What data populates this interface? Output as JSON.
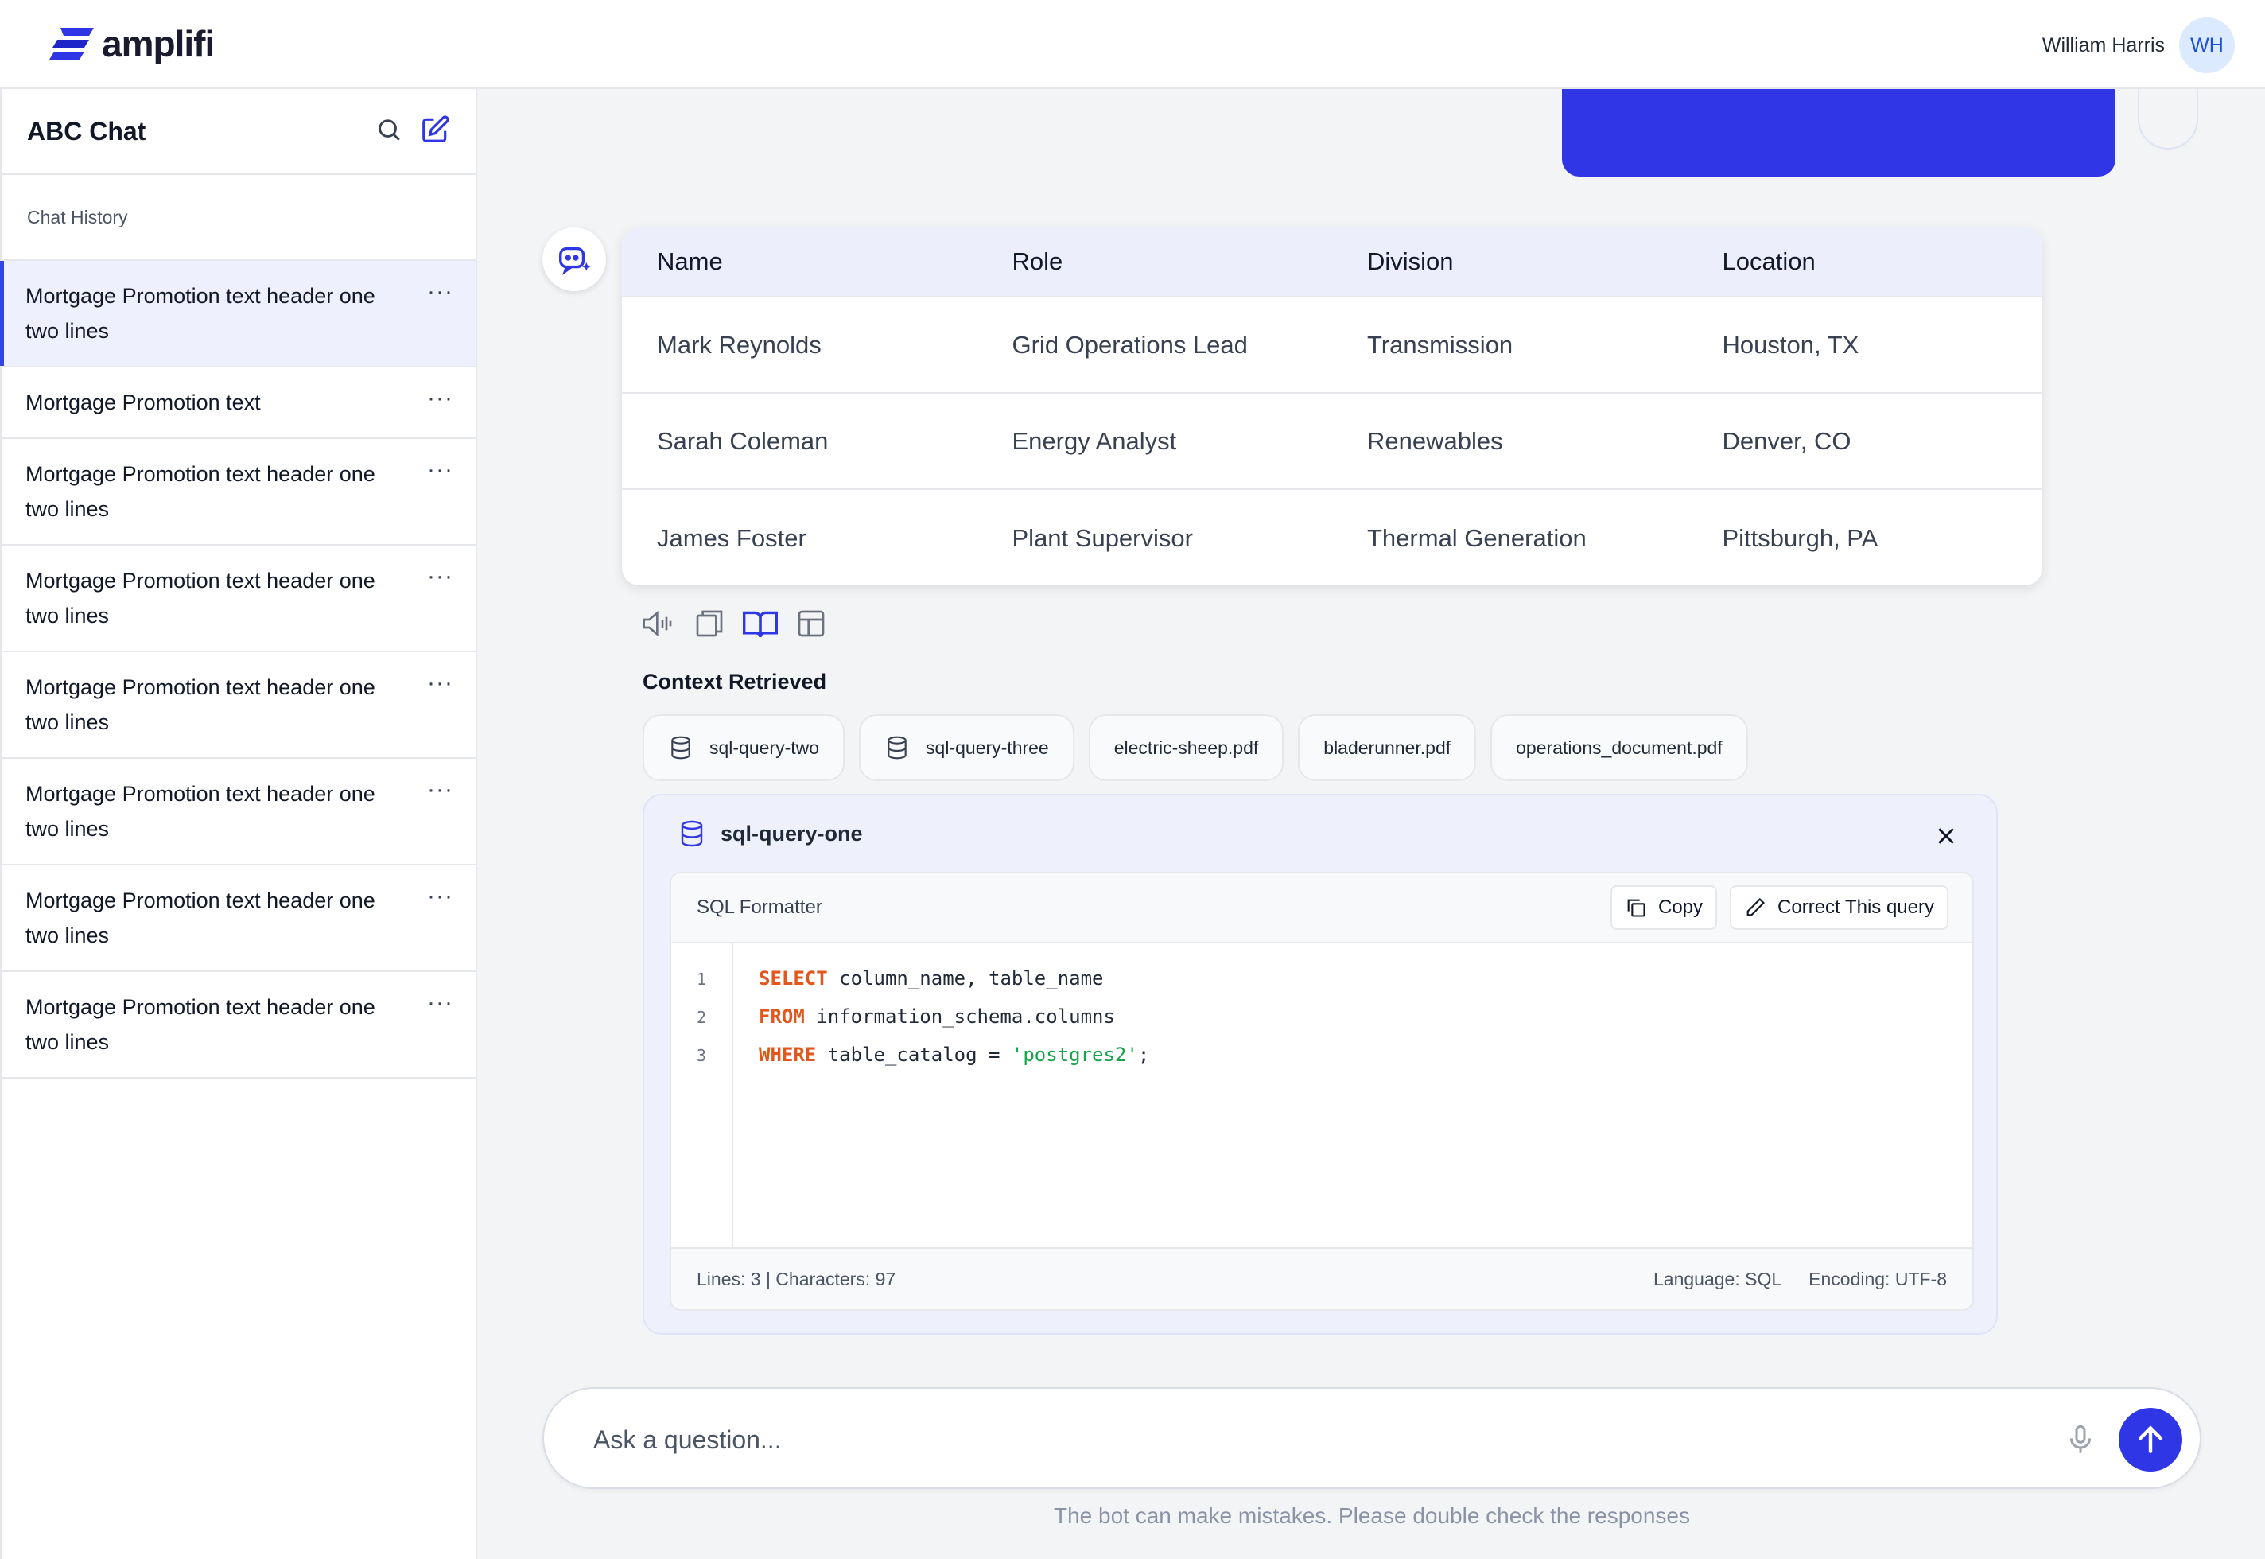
{
  "header": {
    "brand": "amplifi",
    "user_name": "William Harris",
    "user_initials": "WH"
  },
  "sidebar": {
    "title": "ABC Chat",
    "section_label": "Chat History",
    "items": [
      {
        "label": "Mortgage Promotion text header one two lines",
        "active": true
      },
      {
        "label": "Mortgage Promotion text",
        "active": false
      },
      {
        "label": "Mortgage Promotion text header one two lines",
        "active": false
      },
      {
        "label": "Mortgage Promotion text header one two lines",
        "active": false
      },
      {
        "label": "Mortgage Promotion text header one two lines",
        "active": false
      },
      {
        "label": "Mortgage Promotion text header one two lines",
        "active": false
      },
      {
        "label": "Mortgage Promotion text header one two lines",
        "active": false
      },
      {
        "label": "Mortgage Promotion text header one two lines",
        "active": false
      }
    ],
    "more_glyph": "···"
  },
  "table": {
    "columns": [
      "Name",
      "Role",
      "Division",
      "Location"
    ],
    "rows": [
      [
        "Mark Reynolds",
        "Grid Operations Lead",
        "Transmission",
        "Houston, TX"
      ],
      [
        "Sarah Coleman",
        "Energy Analyst",
        "Renewables",
        "Denver, CO"
      ],
      [
        "James Foster",
        "Plant Supervisor",
        "Thermal Generation",
        "Pittsburgh, PA"
      ]
    ]
  },
  "message_actions": [
    "speaker-icon",
    "copy-icon",
    "book-icon",
    "layout-icon"
  ],
  "context": {
    "title": "Context Retrieved",
    "chips": [
      {
        "label": "sql-query-two",
        "icon": "database-icon"
      },
      {
        "label": "sql-query-three",
        "icon": "database-icon"
      },
      {
        "label": "electric-sheep.pdf",
        "icon": ""
      },
      {
        "label": "bladerunner.pdf",
        "icon": ""
      },
      {
        "label": "operations_document.pdf",
        "icon": ""
      }
    ]
  },
  "sql_panel": {
    "title": "sql-query-one",
    "editor_title": "SQL Formatter",
    "copy_label": "Copy",
    "correct_label": "Correct This query",
    "line_numbers": [
      "1",
      "2",
      "3"
    ],
    "code": [
      {
        "kw": "SELECT",
        "rest": " column_name, table_name",
        "str": "",
        "end": ""
      },
      {
        "kw": "FROM",
        "rest": " information_schema.columns",
        "str": "",
        "end": ""
      },
      {
        "kw": "WHERE",
        "rest": " table_catalog = ",
        "str": "'postgres2'",
        "end": ";"
      }
    ],
    "stats": "Lines: 3 | Characters: 97",
    "language": "Language: SQL",
    "encoding": "Encoding: UTF-8"
  },
  "composer": {
    "placeholder": "Ask a question...",
    "disclaimer": "The bot can make mistakes. Please double check the responses"
  },
  "colors": {
    "accent": "#2f36e6",
    "active_bg": "#eef0fd",
    "keyword": "#e2571e",
    "string": "#16a34a"
  }
}
